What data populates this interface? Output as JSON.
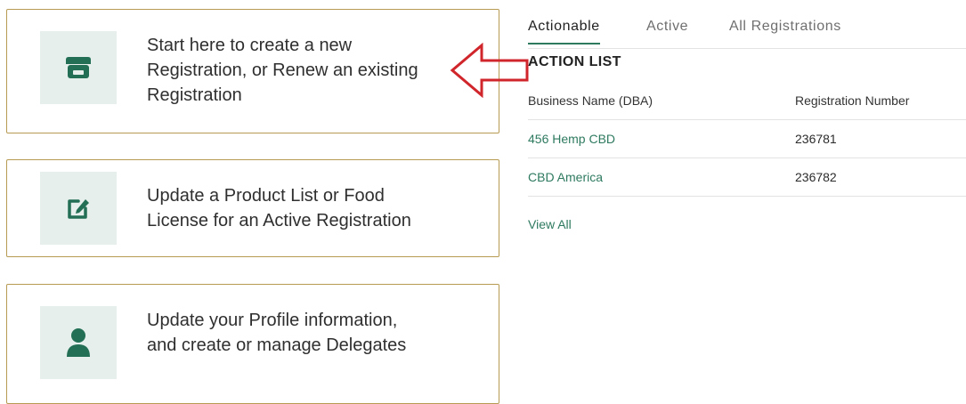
{
  "cards": [
    {
      "lines": [
        "Start here to create a new",
        "Registration, or Renew an existing",
        "Registration"
      ],
      "icon": "storefront-icon"
    },
    {
      "lines": [
        "Update a Product List or Food",
        "License for an Active Registration"
      ],
      "icon": "edit-icon"
    },
    {
      "lines": [
        "Update your Profile information,",
        "and create or manage Delegates"
      ],
      "icon": "user-icon"
    }
  ],
  "tabs": [
    "Actionable",
    "Active",
    "All Registrations"
  ],
  "action_list": {
    "title": "ACTION LIST",
    "columns": [
      "Business Name (DBA)",
      "Registration Number"
    ],
    "rows": [
      {
        "name": "456 Hemp CBD",
        "number": "236781"
      },
      {
        "name": "CBD America",
        "number": "236782"
      }
    ],
    "view_all": "View All"
  },
  "colors": {
    "accent": "#2e7a5f",
    "card_border": "#b89b52",
    "icon_bg": "#e6efec",
    "arrow": "#d0252b"
  }
}
